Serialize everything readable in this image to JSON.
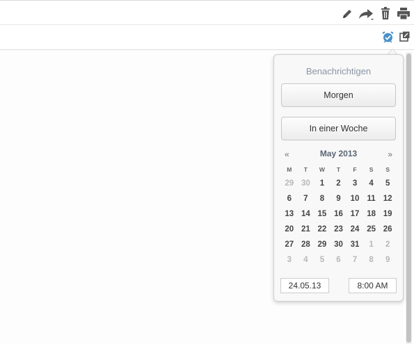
{
  "toolbar": {
    "icons": [
      "pencil-icon",
      "forward-icon",
      "trash-icon",
      "print-icon"
    ],
    "icon_color": "#555555"
  },
  "secondary_toolbar": {
    "icons": [
      "alarm-clock-icon",
      "external-window-icon"
    ],
    "accent_color": "#4a90c8"
  },
  "reminder_popover": {
    "title": "Benachrichtigen",
    "tomorrow_label": "Morgen",
    "next_week_label": "In einer Woche",
    "calendar": {
      "prev_label": "«",
      "next_label": "»",
      "month_title": "May 2013",
      "weekdays": [
        "M",
        "T",
        "W",
        "T",
        "F",
        "S",
        "S"
      ],
      "weeks": [
        [
          {
            "d": "29",
            "m": true
          },
          {
            "d": "30",
            "m": true
          },
          {
            "d": "1",
            "m": false
          },
          {
            "d": "2",
            "m": false
          },
          {
            "d": "3",
            "m": false
          },
          {
            "d": "4",
            "m": false
          },
          {
            "d": "5",
            "m": false
          }
        ],
        [
          {
            "d": "6",
            "m": false
          },
          {
            "d": "7",
            "m": false
          },
          {
            "d": "8",
            "m": false
          },
          {
            "d": "9",
            "m": false
          },
          {
            "d": "10",
            "m": false
          },
          {
            "d": "11",
            "m": false
          },
          {
            "d": "12",
            "m": false
          }
        ],
        [
          {
            "d": "13",
            "m": false
          },
          {
            "d": "14",
            "m": false
          },
          {
            "d": "15",
            "m": false
          },
          {
            "d": "16",
            "m": false
          },
          {
            "d": "17",
            "m": false
          },
          {
            "d": "18",
            "m": false
          },
          {
            "d": "19",
            "m": false
          }
        ],
        [
          {
            "d": "20",
            "m": false
          },
          {
            "d": "21",
            "m": false
          },
          {
            "d": "22",
            "m": false
          },
          {
            "d": "23",
            "m": false
          },
          {
            "d": "24",
            "m": false
          },
          {
            "d": "25",
            "m": false
          },
          {
            "d": "26",
            "m": false
          }
        ],
        [
          {
            "d": "27",
            "m": false
          },
          {
            "d": "28",
            "m": false
          },
          {
            "d": "29",
            "m": false
          },
          {
            "d": "30",
            "m": false
          },
          {
            "d": "31",
            "m": false
          },
          {
            "d": "1",
            "m": true
          },
          {
            "d": "2",
            "m": true
          }
        ],
        [
          {
            "d": "3",
            "m": true
          },
          {
            "d": "4",
            "m": true
          },
          {
            "d": "5",
            "m": true
          },
          {
            "d": "6",
            "m": true
          },
          {
            "d": "7",
            "m": true
          },
          {
            "d": "8",
            "m": true
          },
          {
            "d": "9",
            "m": true
          }
        ]
      ]
    },
    "date_value": "24.05.13",
    "time_value": "8:00 AM"
  }
}
